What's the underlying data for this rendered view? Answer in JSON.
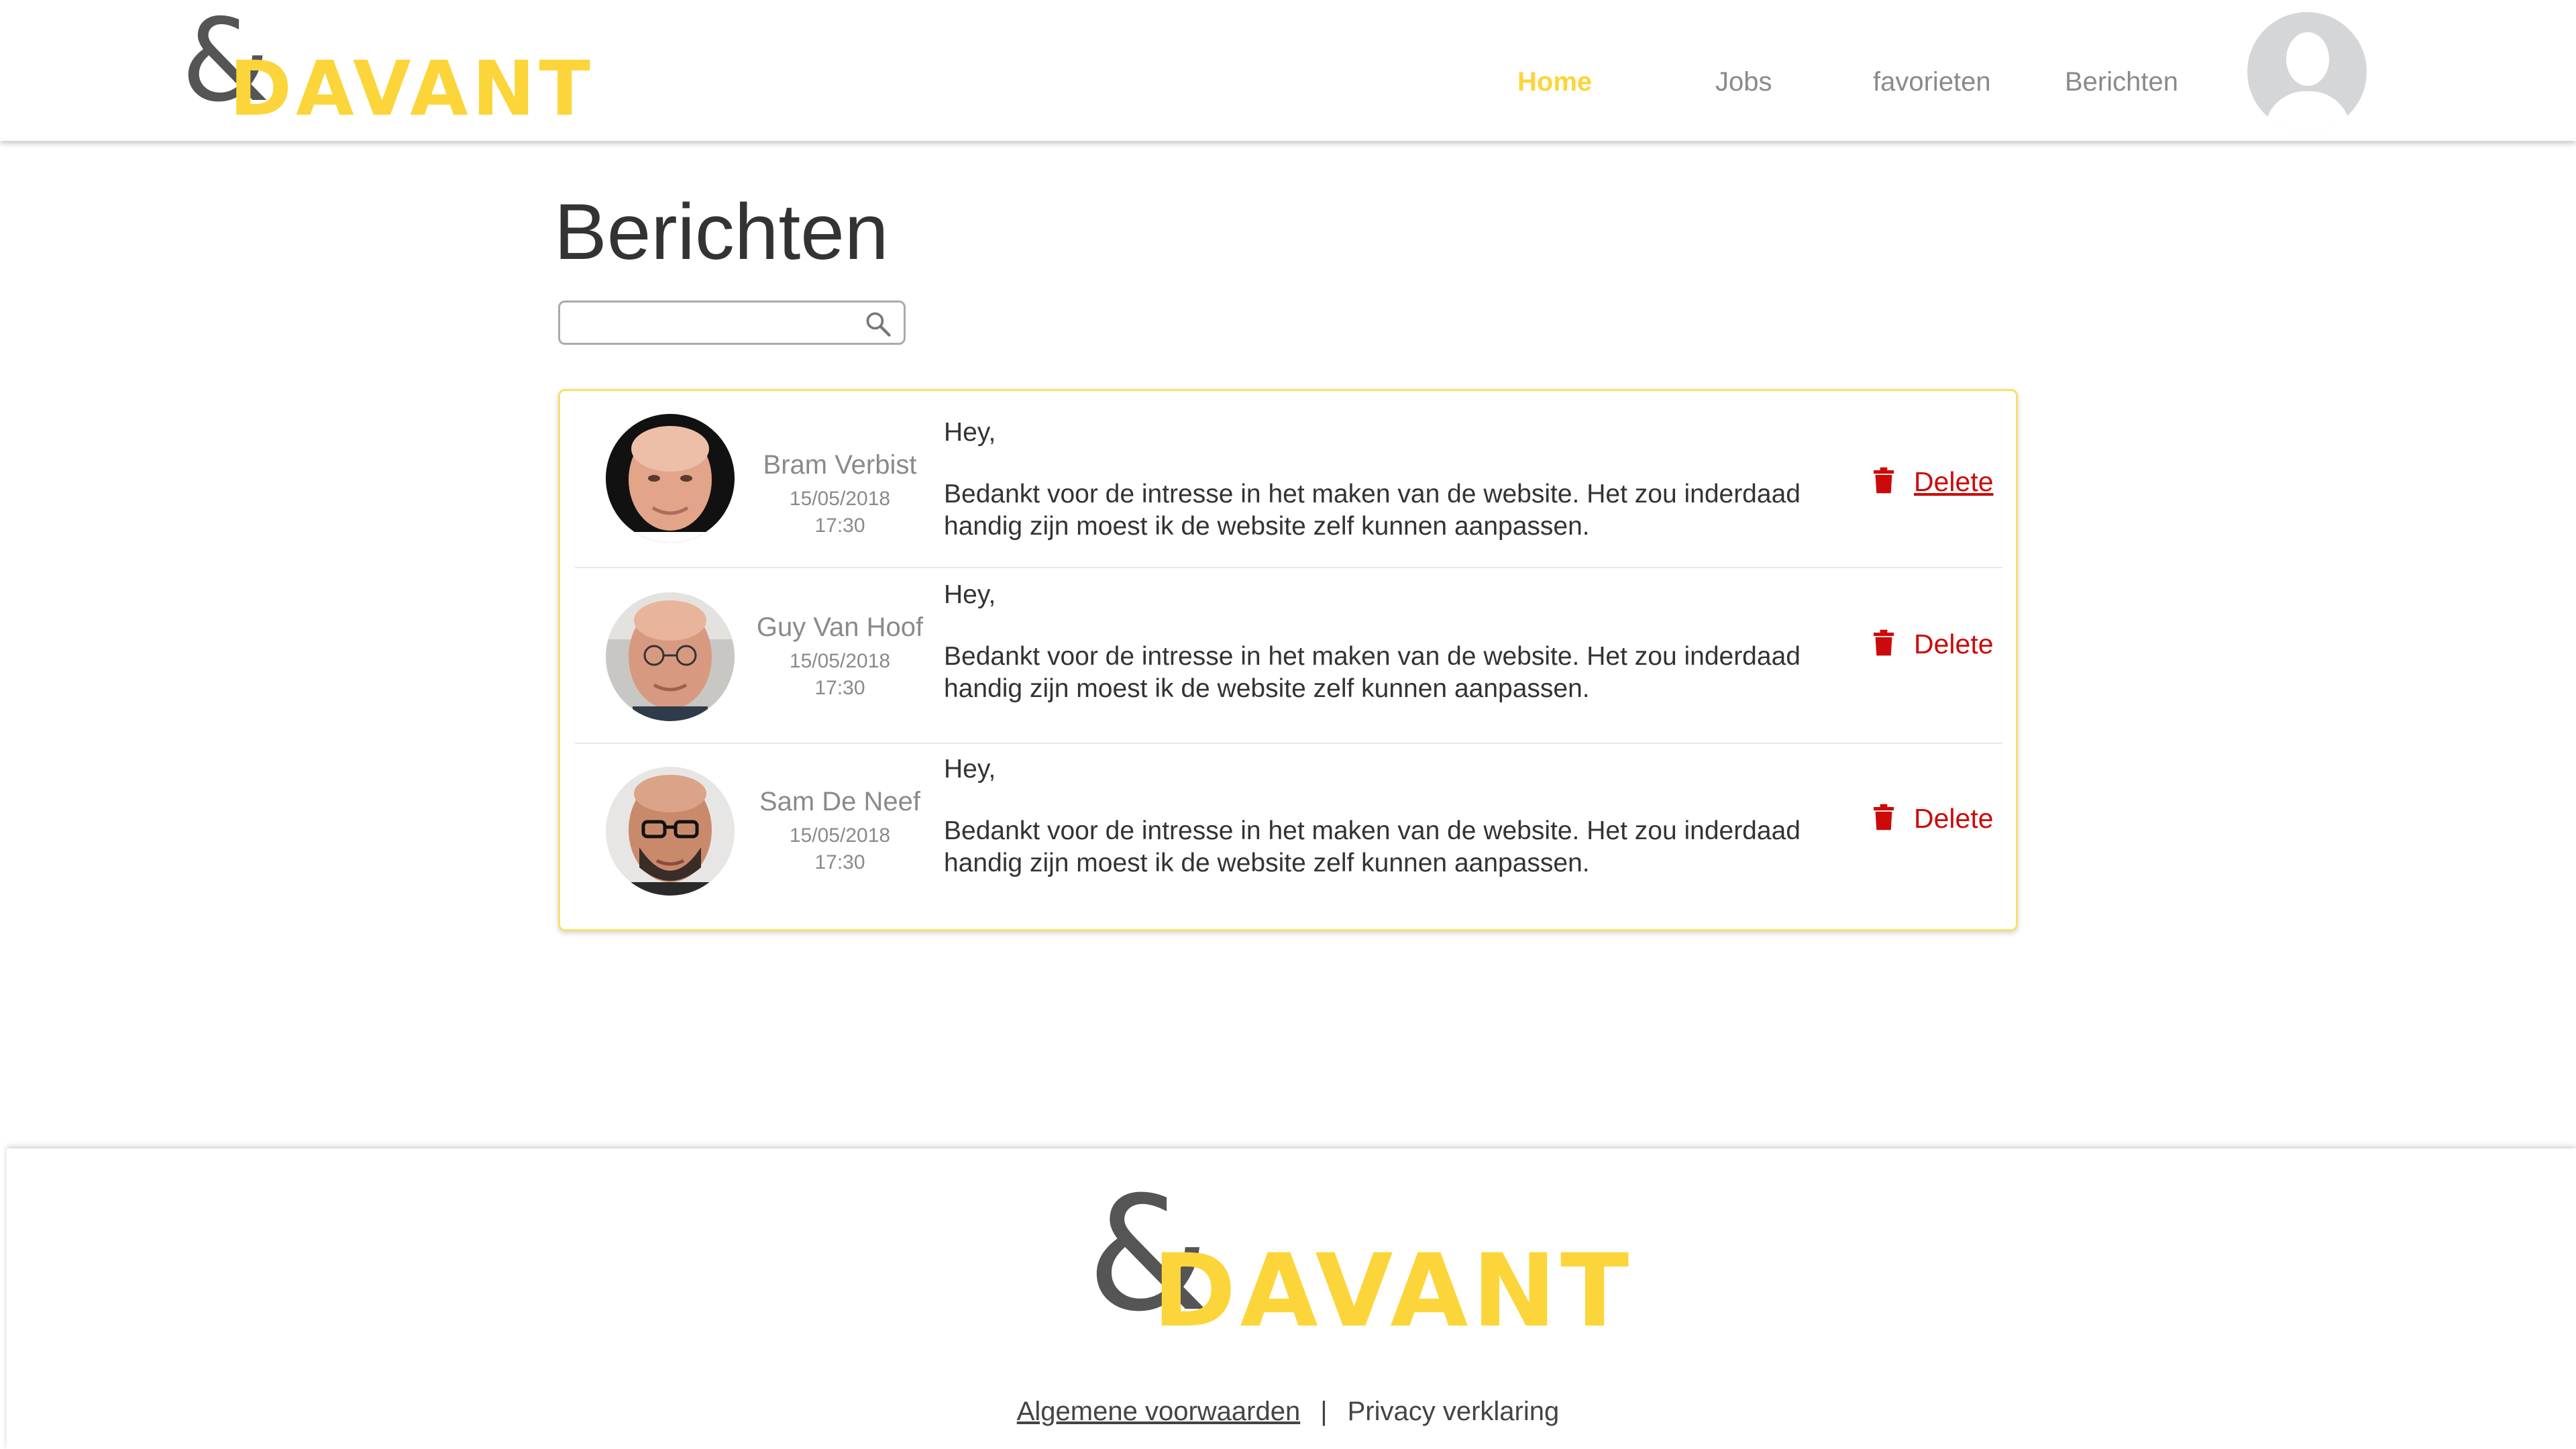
{
  "brand": {
    "amp": "&",
    "word": "DAVANT"
  },
  "nav": {
    "items": [
      {
        "label": "Home",
        "active": true
      },
      {
        "label": "Jobs",
        "active": false
      },
      {
        "label": "favorieten",
        "active": false
      },
      {
        "label": "Berichten",
        "active": false
      }
    ]
  },
  "page": {
    "title": "Berichten",
    "search": {
      "value": "",
      "placeholder": ""
    }
  },
  "messages": [
    {
      "sender": "Bram Verbist",
      "date": "15/05/2018",
      "time": "17:30",
      "greeting": "Hey,",
      "line1": "Bedankt voor de intresse in het maken van de website. Het zou inderdaad",
      "line2": "handig zijn moest ik de website zelf kunnen aanpassen.",
      "delete_label": "Delete"
    },
    {
      "sender": "Guy Van Hoof",
      "date": "15/05/2018",
      "time": "17:30",
      "greeting": "Hey,",
      "line1": "Bedankt voor de intresse in het maken van de website. Het zou inderdaad",
      "line2": "handig zijn moest ik de website zelf kunnen aanpassen.",
      "delete_label": "Delete"
    },
    {
      "sender": "Sam De Neef",
      "date": "15/05/2018",
      "time": "17:30",
      "greeting": "Hey,",
      "line1": "Bedankt voor de intresse in het maken van de website. Het zou inderdaad",
      "line2": "handig zijn moest ik de website zelf kunnen aanpassen.",
      "delete_label": "Delete"
    }
  ],
  "footer": {
    "terms": "Algemene voorwaarden",
    "separator": "|",
    "privacy": "Privacy verklaring"
  },
  "colors": {
    "accent": "#fcd53a",
    "delete": "#cc0a0a",
    "text": "#333333",
    "muted": "#8a8a8a"
  }
}
